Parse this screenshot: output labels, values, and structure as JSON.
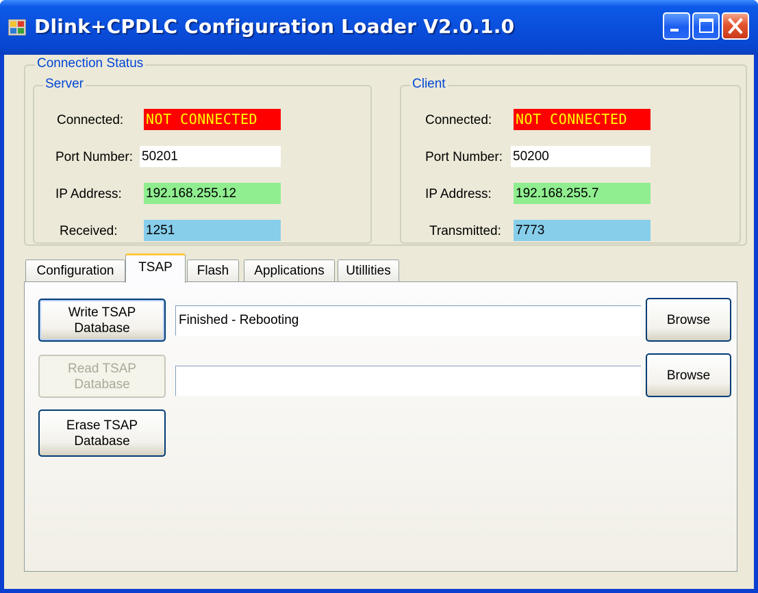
{
  "window": {
    "title": "Dlink+CPDLC Configuration Loader V2.0.1.0"
  },
  "connection_status": {
    "legend": "Connection Status",
    "server": {
      "legend": "Server",
      "connected_label": "Connected:",
      "connected_value": "NOT CONNECTED",
      "port_label": "Port Number:",
      "port_value": "50201",
      "ip_label": "IP Address:",
      "ip_value": "192.168.255.12",
      "count_label": "Received:",
      "count_value": "1251"
    },
    "client": {
      "legend": "Client",
      "connected_label": "Connected:",
      "connected_value": "NOT CONNECTED",
      "port_label": "Port Number:",
      "port_value": "50200",
      "ip_label": "IP Address:",
      "ip_value": "192.168.255.7",
      "count_label": "Transmitted:",
      "count_value": "7773"
    }
  },
  "tabs": [
    {
      "label": "Configuration"
    },
    {
      "label": "TSAP"
    },
    {
      "label": "Flash"
    },
    {
      "label": "Applications"
    },
    {
      "label": "Utillities"
    }
  ],
  "tsap": {
    "write_button": {
      "line1": "Write TSAP",
      "line2": "Database"
    },
    "write_path": "Finished - Rebooting",
    "read_button": {
      "line1": "Read TSAP",
      "line2": "Database"
    },
    "read_path": "",
    "erase_button": {
      "line1": "Erase TSAP",
      "line2": "Database"
    },
    "browse_label": "Browse"
  },
  "colors": {
    "not_connected_bg": "#ff0000",
    "not_connected_text": "#ffff00",
    "ip_bg": "#90ee90",
    "count_bg": "#87ceeb",
    "group_legend": "#0046d5"
  }
}
